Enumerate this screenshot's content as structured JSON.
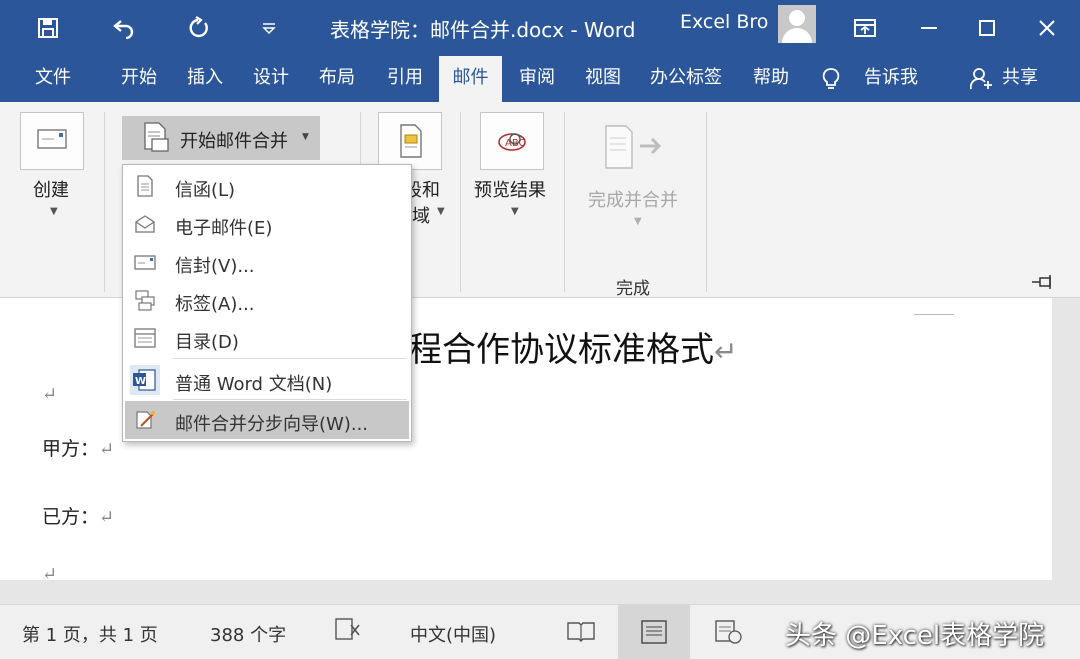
{
  "titlebar": {
    "title": "表格学院：邮件合并.docx  -  Word",
    "user": "Excel Bro",
    "icons": [
      "save-icon",
      "undo-icon",
      "redo-icon",
      "customize-icon",
      "ribbon-display-icon",
      "minimize-icon",
      "maximize-icon",
      "close-icon"
    ]
  },
  "menu": {
    "tabs": [
      "文件",
      "开始",
      "插入",
      "设计",
      "布局",
      "引用",
      "邮件",
      "审阅",
      "视图",
      "办公标签",
      "帮助"
    ],
    "active": "邮件",
    "tell_me": "告诉我",
    "share": "共享"
  },
  "ribbon": {
    "create_label": "创建",
    "start_merge_label": "开始邮件合并",
    "fields_partial_1": "段和",
    "fields_partial_2": "域",
    "preview_label": "预览结果",
    "finish_merge_label": "完成并合并",
    "finish_group_label": "完成"
  },
  "dropdown": {
    "items": [
      {
        "label": "信函(L)",
        "icon": "letter-icon"
      },
      {
        "label": "电子邮件(E)",
        "icon": "email-icon"
      },
      {
        "label": "信封(V)...",
        "icon": "envelope-icon"
      },
      {
        "label": "标签(A)...",
        "icon": "labels-icon"
      },
      {
        "label": "目录(D)",
        "icon": "directory-icon"
      },
      {
        "label": "普通 Word 文档(N)",
        "icon": "word-doc-icon"
      },
      {
        "label": "邮件合并分步向导(W)...",
        "icon": "wizard-icon"
      }
    ],
    "highlighted": "邮件合并分步向导(W)..."
  },
  "document": {
    "title": "程合作协议标准格式",
    "party_a": "甲方：",
    "party_b": "已方：",
    "return_mark": "↵"
  },
  "statusbar": {
    "page": "第 1 页，共 1 页",
    "words": "388 个字",
    "language": "中文(中国)",
    "watermark": "头条 @Excel表格学院"
  }
}
